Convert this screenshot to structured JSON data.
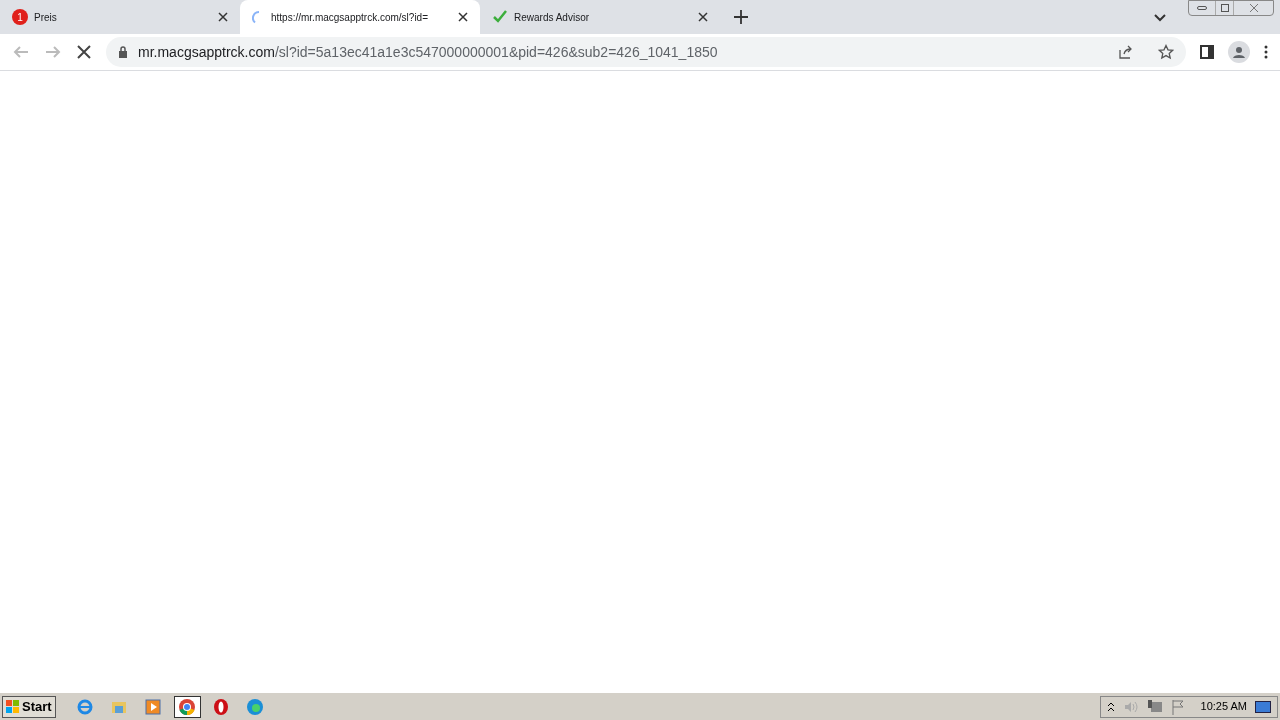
{
  "tabs": [
    {
      "title": "Preis",
      "kind": "badge",
      "badge": "1",
      "selected": false
    },
    {
      "title": "https://mr.macgsapptrck.com/sl?id=",
      "kind": "spinner",
      "selected": true
    },
    {
      "title": "Rewards Advisor",
      "kind": "check",
      "selected": false
    }
  ],
  "address": {
    "host": "mr.macgsapptrck.com",
    "path": "/sl?id=5a13ec41a1e3c547000000001&pid=426&sub2=426_1041_1850"
  },
  "taskbar": {
    "start": "Start",
    "apps": [
      {
        "kind": "ie",
        "selected": false
      },
      {
        "kind": "folder",
        "selected": false
      },
      {
        "kind": "media",
        "selected": false
      },
      {
        "kind": "chrome",
        "selected": true
      },
      {
        "kind": "opera",
        "selected": false
      },
      {
        "kind": "edge",
        "selected": false
      }
    ],
    "clock": "10:25 AM"
  }
}
